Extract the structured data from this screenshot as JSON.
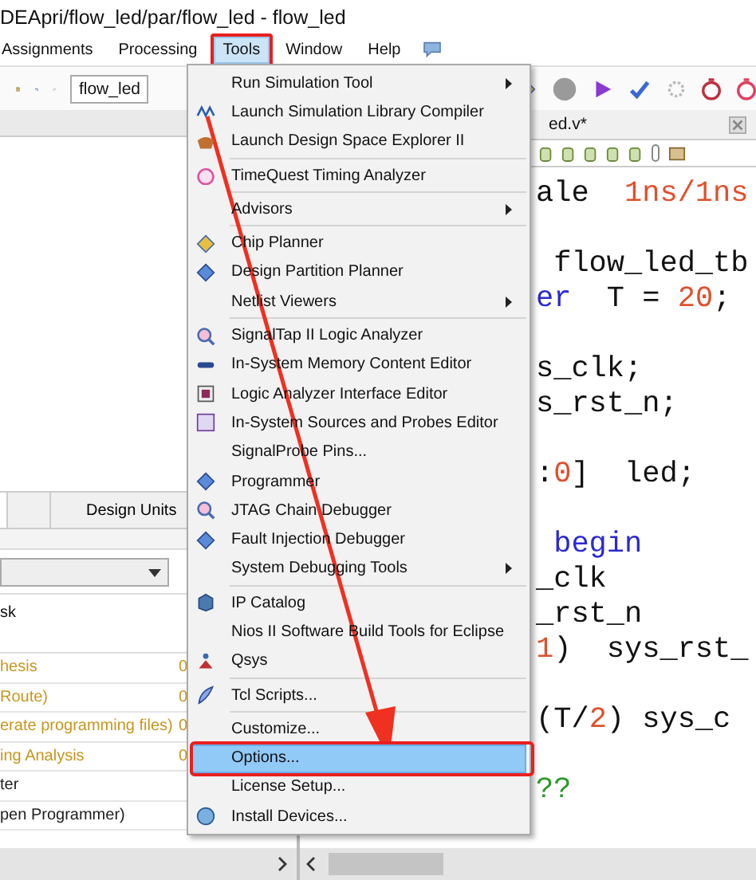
{
  "window": {
    "title": "DEApri/flow_led/par/flow_led - flow_led"
  },
  "menu_bar": [
    {
      "label": "Assignments",
      "selected": false,
      "highlighted": false
    },
    {
      "label": "Processing",
      "selected": false,
      "highlighted": false
    },
    {
      "label": "Tools",
      "selected": true,
      "highlighted": true
    },
    {
      "label": "Window",
      "selected": false,
      "highlighted": false
    },
    {
      "label": "Help",
      "selected": false,
      "highlighted": false
    }
  ],
  "toolbar": {
    "combo_value": "flow_led"
  },
  "left_panel": {
    "tabs": [
      {
        "label": "Design Units",
        "selected": false
      }
    ],
    "table": {
      "columns": [
        {
          "label": "sk"
        }
      ],
      "rows": [
        {
          "cells": [
            "hesis",
            "0"
          ],
          "color": "#c8961e"
        },
        {
          "cells": [
            "Route)",
            "0"
          ],
          "color": "#c8961e"
        },
        {
          "cells": [
            "erate programming files)",
            "0"
          ],
          "color": "#c8961e"
        },
        {
          "cells": [
            "ing Analysis",
            "0"
          ],
          "color": "#c8961e"
        },
        {
          "cells": [
            "ter"
          ],
          "color": "#202020"
        },
        {
          "cells": [
            "pen Programmer)"
          ],
          "color": "#202020"
        }
      ]
    }
  },
  "editor": {
    "tab": "ed.v*",
    "lines": [
      [
        {
          "kind": "plain",
          "text": "ale  "
        },
        {
          "kind": "number",
          "text": "1ns/1ns"
        }
      ],
      [
        {
          "kind": "plain",
          "text": " flow_led_tb"
        }
      ],
      [
        {
          "kind": "keyword",
          "text": "er"
        },
        {
          "kind": "plain",
          "text": "  T = "
        },
        {
          "kind": "number",
          "text": "20"
        },
        {
          "kind": "plain",
          "text": ";"
        }
      ],
      [
        {
          "kind": "plain",
          "text": "s_clk;"
        }
      ],
      [
        {
          "kind": "plain",
          "text": "s_rst_n;"
        }
      ],
      [
        {
          "kind": "plain",
          "text": ":"
        },
        {
          "kind": "number",
          "text": "0"
        },
        {
          "kind": "plain",
          "text": "]  led;"
        }
      ],
      [
        {
          "kind": "keyword",
          "text": " begin"
        }
      ],
      [
        {
          "kind": "plain",
          "text": "_clk"
        }
      ],
      [
        {
          "kind": "plain",
          "text": "_rst_n"
        }
      ],
      [
        {
          "kind": "number",
          "text": "1"
        },
        {
          "kind": "plain",
          "text": ")  sys_rst_"
        }
      ],
      [
        {
          "kind": "plain",
          "text": "(T/"
        },
        {
          "kind": "number",
          "text": "2"
        },
        {
          "kind": "plain",
          "text": ") sys_c"
        }
      ],
      [
        {
          "kind": "comment",
          "text": "??"
        }
      ]
    ]
  },
  "tools_menu": {
    "groups": [
      [
        {
          "label": "Run Simulation Tool",
          "has_icon": false,
          "submenu": true,
          "selected": false,
          "highlighted": false
        },
        {
          "label": "Launch Simulation Library Compiler",
          "has_icon": true,
          "submenu": false,
          "selected": false,
          "highlighted": false
        },
        {
          "label": "Launch Design Space Explorer II",
          "has_icon": true,
          "submenu": false,
          "selected": false,
          "highlighted": false
        }
      ],
      [
        {
          "label": "TimeQuest Timing Analyzer",
          "has_icon": true,
          "submenu": false,
          "selected": false,
          "highlighted": false
        }
      ],
      [
        {
          "label": "Advisors",
          "has_icon": false,
          "submenu": true,
          "selected": false,
          "highlighted": false
        }
      ],
      [
        {
          "label": "Chip Planner",
          "has_icon": true,
          "submenu": false,
          "selected": false,
          "highlighted": false
        },
        {
          "label": "Design Partition Planner",
          "has_icon": true,
          "submenu": false,
          "selected": false,
          "highlighted": false
        },
        {
          "label": "Netlist Viewers",
          "has_icon": false,
          "submenu": true,
          "selected": false,
          "highlighted": false
        }
      ],
      [
        {
          "label": "SignalTap II Logic Analyzer",
          "has_icon": true,
          "submenu": false,
          "selected": false,
          "highlighted": false
        },
        {
          "label": "In-System Memory Content Editor",
          "has_icon": true,
          "submenu": false,
          "selected": false,
          "highlighted": false
        },
        {
          "label": "Logic Analyzer Interface Editor",
          "has_icon": true,
          "submenu": false,
          "selected": false,
          "highlighted": false
        },
        {
          "label": "In-System Sources and Probes Editor",
          "has_icon": true,
          "submenu": false,
          "selected": false,
          "highlighted": false
        },
        {
          "label": "SignalProbe Pins...",
          "has_icon": false,
          "submenu": false,
          "selected": false,
          "highlighted": false
        },
        {
          "label": "Programmer",
          "has_icon": true,
          "submenu": false,
          "selected": false,
          "highlighted": false
        },
        {
          "label": "JTAG Chain Debugger",
          "has_icon": true,
          "submenu": false,
          "selected": false,
          "highlighted": false
        },
        {
          "label": "Fault Injection Debugger",
          "has_icon": true,
          "submenu": false,
          "selected": false,
          "highlighted": false
        },
        {
          "label": "System Debugging Tools",
          "has_icon": false,
          "submenu": true,
          "selected": false,
          "highlighted": false
        }
      ],
      [
        {
          "label": "IP Catalog",
          "has_icon": true,
          "submenu": false,
          "selected": false,
          "highlighted": false
        },
        {
          "label": "Nios II Software Build Tools for Eclipse",
          "has_icon": false,
          "submenu": false,
          "selected": false,
          "highlighted": false
        },
        {
          "label": "Qsys",
          "has_icon": true,
          "submenu": false,
          "selected": false,
          "highlighted": false
        }
      ],
      [
        {
          "label": "Tcl Scripts...",
          "has_icon": true,
          "submenu": false,
          "selected": false,
          "highlighted": false
        }
      ],
      [
        {
          "label": "Customize...",
          "has_icon": false,
          "submenu": false,
          "selected": false,
          "highlighted": false
        },
        {
          "label": "Options...",
          "has_icon": false,
          "submenu": false,
          "selected": true,
          "highlighted": true
        },
        {
          "label": "License Setup...",
          "has_icon": false,
          "submenu": false,
          "selected": false,
          "highlighted": false
        },
        {
          "label": "Install Devices...",
          "has_icon": true,
          "submenu": false,
          "selected": false,
          "highlighted": false
        }
      ]
    ]
  },
  "annotations": {
    "arrow": true
  }
}
